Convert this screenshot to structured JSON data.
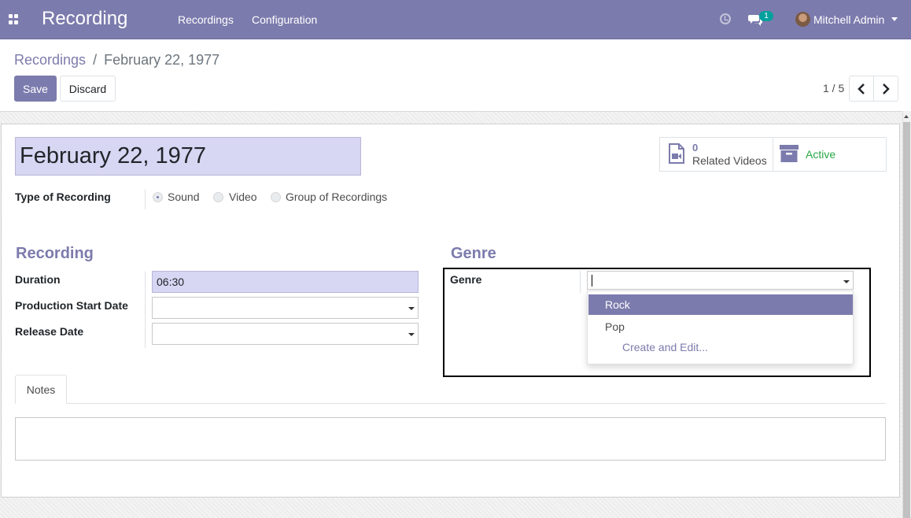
{
  "navbar": {
    "brand": "Recording",
    "menu": [
      "Recordings",
      "Configuration"
    ],
    "chat_badge": "1",
    "user_name": "Mitchell Admin"
  },
  "breadcrumb": {
    "parent": "Recordings",
    "separator": "/",
    "current": "February 22, 1977"
  },
  "actions": {
    "save": "Save",
    "discard": "Discard"
  },
  "pager": {
    "value": "1 / 5"
  },
  "record": {
    "title": "February 22, 1977",
    "smart_buttons": {
      "videos_count": "0",
      "videos_label": "Related Videos",
      "active_label": "Active"
    },
    "type_label": "Type of Recording",
    "type_options": [
      "Sound",
      "Video",
      "Group of Recordings"
    ],
    "type_selected": "Sound"
  },
  "recording_section": {
    "title": "Recording",
    "duration_label": "Duration",
    "duration_value": "06:30",
    "production_label": "Production Start Date",
    "production_value": "",
    "release_label": "Release Date",
    "release_value": ""
  },
  "genre_section": {
    "title": "Genre",
    "genre_label": "Genre",
    "genre_value": "",
    "dropdown_options": [
      "Rock",
      "Pop"
    ],
    "dropdown_highlighted": "Rock",
    "create_and_edit": "Create and Edit..."
  },
  "notes": {
    "tab_label": "Notes",
    "content": ""
  },
  "colors": {
    "brand": "#7C7BAD",
    "active_green": "#28a745",
    "badge_teal": "#00A09D",
    "required_field_bg": "#d7d6f3"
  }
}
